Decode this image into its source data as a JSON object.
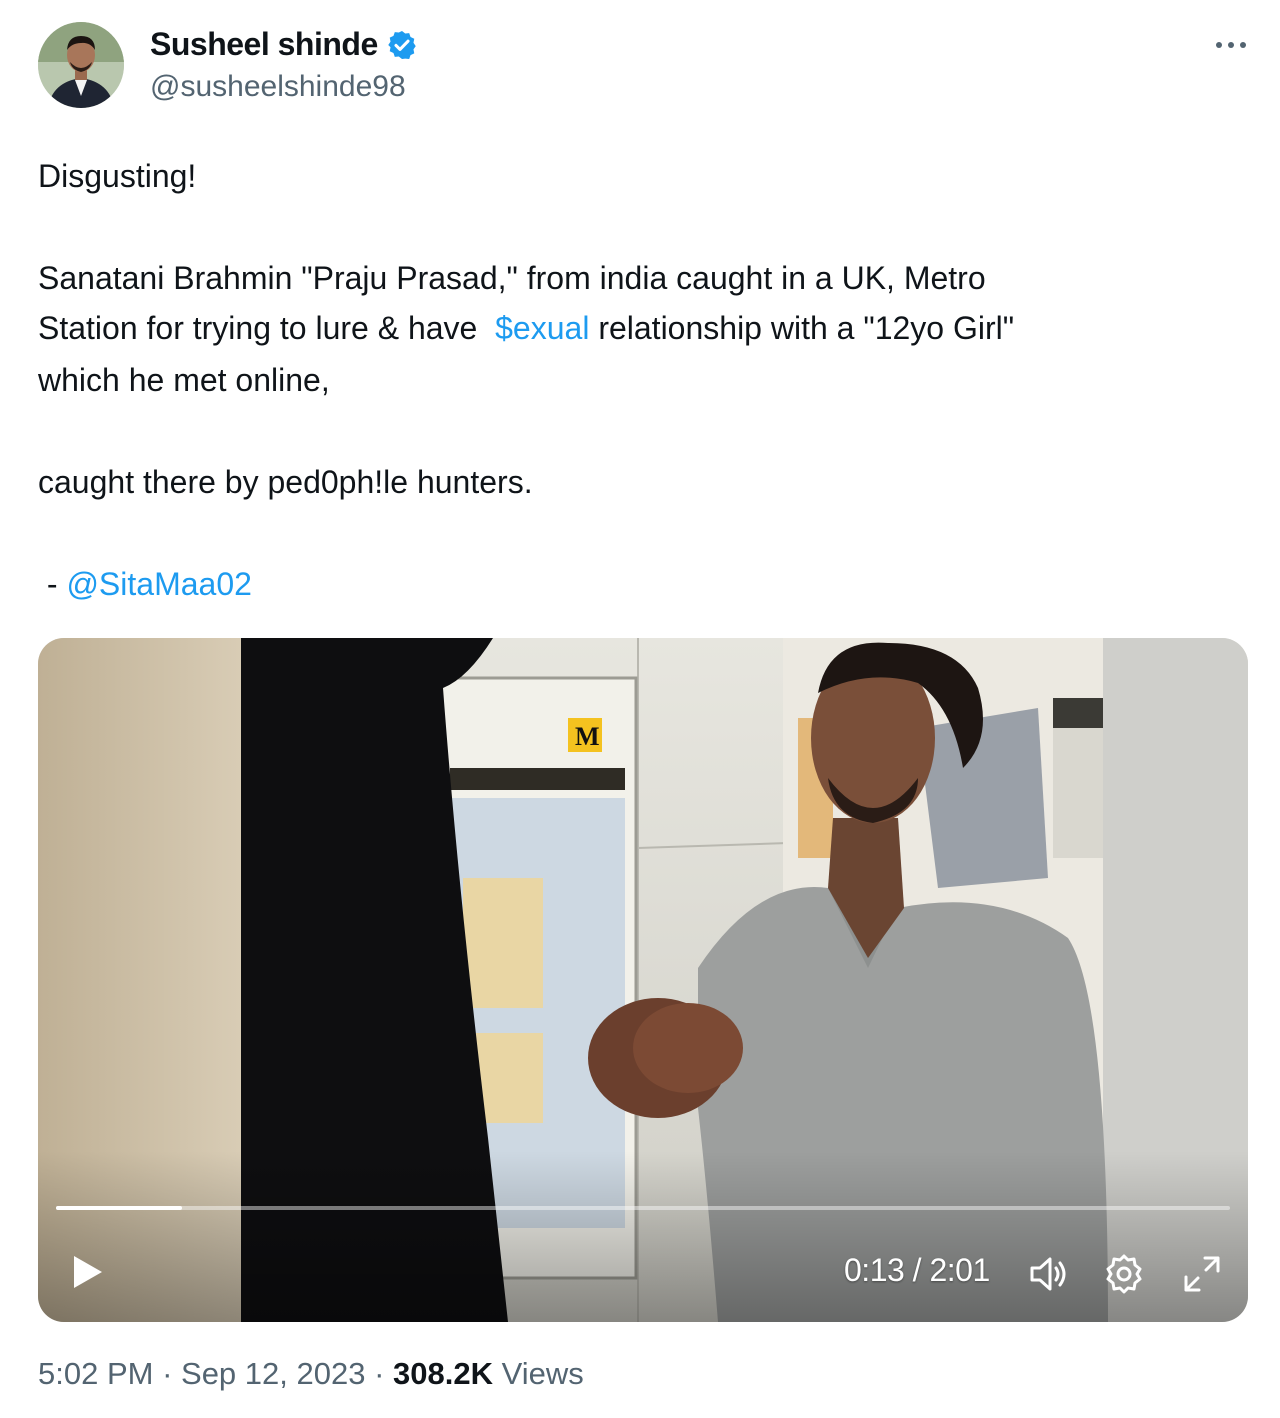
{
  "author": {
    "display_name": "Susheel shinde",
    "handle": "@susheelshinde98"
  },
  "tweet": {
    "line_1": "Disgusting!",
    "line_2": "Sanatani Brahmin \"Praju Prasad,\" from india caught in a UK, Metro",
    "line_3_before": "Station for trying to lure & have  ",
    "line_3_link": "$exual",
    "line_3_after": " relationship with a \"12yo Girl\"",
    "line_4": "which he met online,",
    "line_5": "caught there by ped0ph!le hunters.",
    "credit_prefix": " - ",
    "credit_mention": "@SitaMaa02"
  },
  "video": {
    "time": "0:13 / 2:01",
    "progress_fraction": 0.107
  },
  "meta": {
    "time": "5:02 PM",
    "separator": " · ",
    "date": "Sep 12, 2023",
    "views_count": "308.2K",
    "views_label": "Views"
  },
  "colors": {
    "link": "#1d9bf0",
    "verified": "#1d9bf0",
    "secondary_text": "#536471"
  },
  "icons": [
    "verified-badge-icon",
    "more-icon",
    "play-icon",
    "volume-icon",
    "settings-icon",
    "fullscreen-icon"
  ]
}
